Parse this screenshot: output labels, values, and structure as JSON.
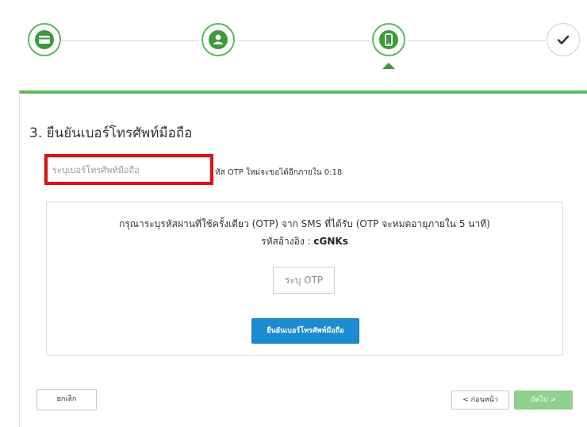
{
  "stepper": {
    "steps": [
      {
        "name": "payment",
        "icon": "card-icon",
        "state": "done"
      },
      {
        "name": "account",
        "icon": "user-icon",
        "state": "done"
      },
      {
        "name": "mobile",
        "icon": "mobile-icon",
        "state": "current"
      },
      {
        "name": "confirm",
        "icon": "check-icon",
        "state": "pending"
      }
    ],
    "accent_color": "#5cb85c"
  },
  "section": {
    "title": "3. ยืนยันเบอร์โทรศัพท์มือถือ"
  },
  "phone": {
    "placeholder": "ระบุเบอร์โทรศัพท์มือถือ",
    "value": "",
    "otp_resend_note": "หัส OTP ใหม่จะขอได้อีกภายใน 0:18"
  },
  "otp": {
    "instruction": "กรุณาระบุรหัสผ่านที่ใช้ครั้งเดียว (OTP) จาก SMS ที่ได้รับ (OTP จะหมดอายุภายใน 5 นาที)",
    "ref_label": "รหัสอ้างอิง : ",
    "ref_code": "cGNKs",
    "input_placeholder": "ระบุ OTP",
    "confirm_label": "ยืนยันเบอร์โทรศัพท์มือถือ"
  },
  "footer": {
    "cancel_label": "ยกเลิก",
    "prev_label": "< ก่อนหน้า",
    "next_label": "ถัดไป >"
  },
  "colors": {
    "primary_button": "#1a8ccf",
    "disabled_next": "#8fd08f",
    "highlight": "#e01010"
  }
}
